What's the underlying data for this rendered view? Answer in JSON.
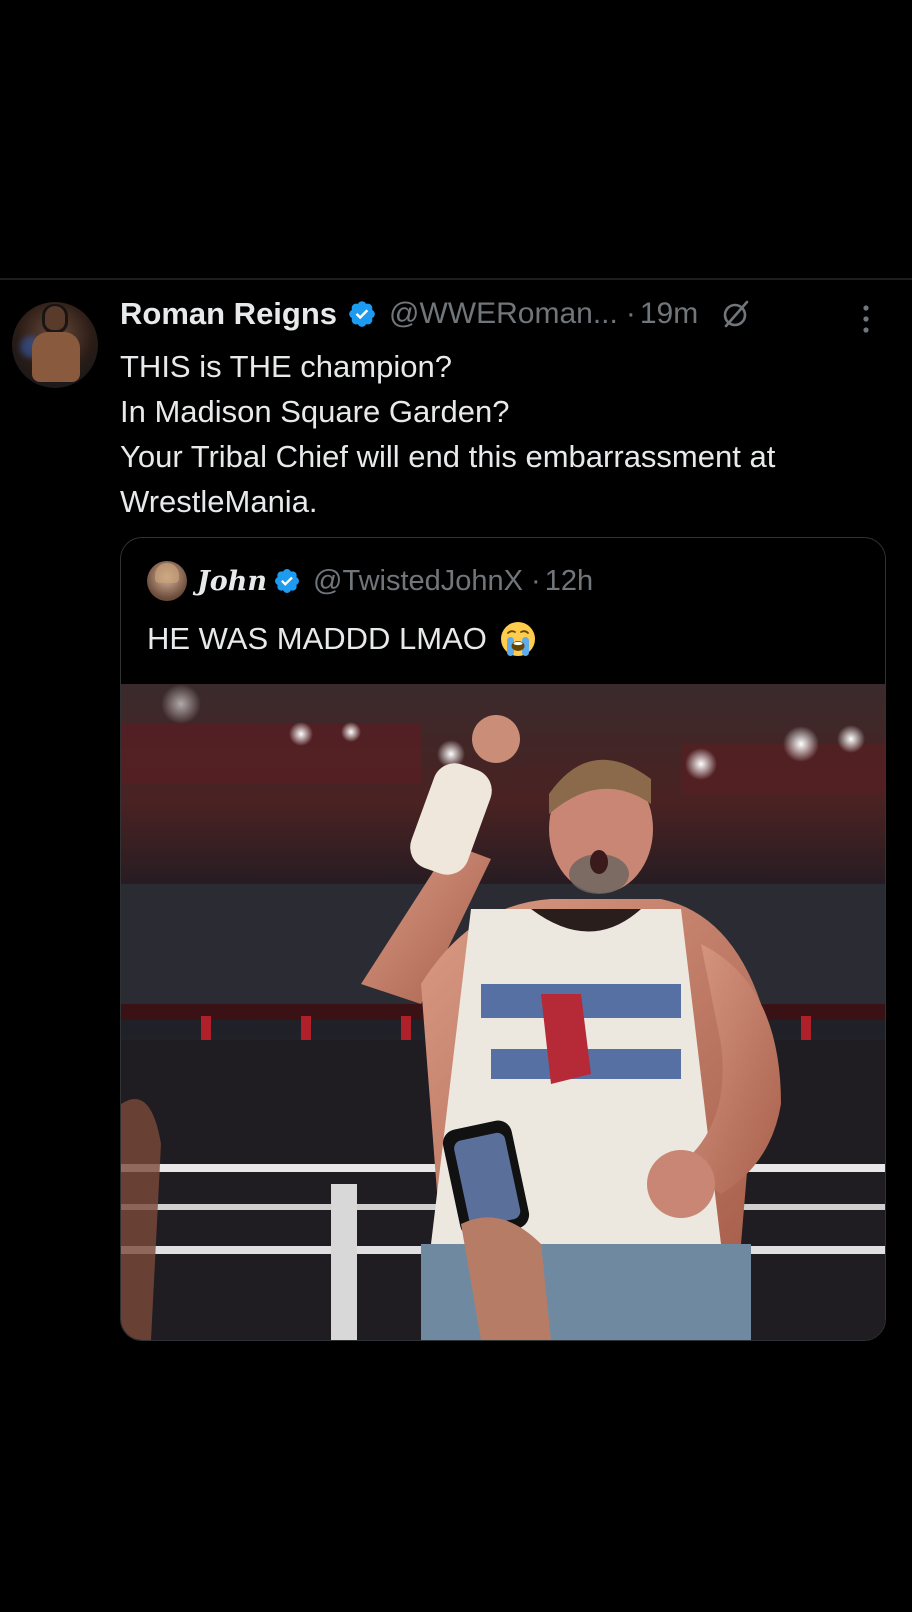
{
  "tweet": {
    "author_name": "Roman Reigns",
    "handle": "@WWERoman...",
    "separator": "·",
    "time": "19m",
    "lines": [
      "THIS is THE champion?",
      "In Madison Square Garden?",
      "Your Tribal Chief will end this embarrassment at",
      "WrestleMania."
    ]
  },
  "quoted": {
    "author_name": "John",
    "handle": "@TwistedJohnX",
    "separator": "·",
    "time": "12h",
    "text": "HE WAS MADDD LMAO",
    "emoji": "loudly-crying-face"
  },
  "icons": {
    "verified": "verified-badge-icon",
    "grok": "grok-icon",
    "more": "more-options-icon"
  },
  "colors": {
    "background": "#000000",
    "text_primary": "#e7e9ea",
    "text_secondary": "#71767b",
    "verified_blue": "#1d9bf0",
    "border": "#2f3336"
  }
}
